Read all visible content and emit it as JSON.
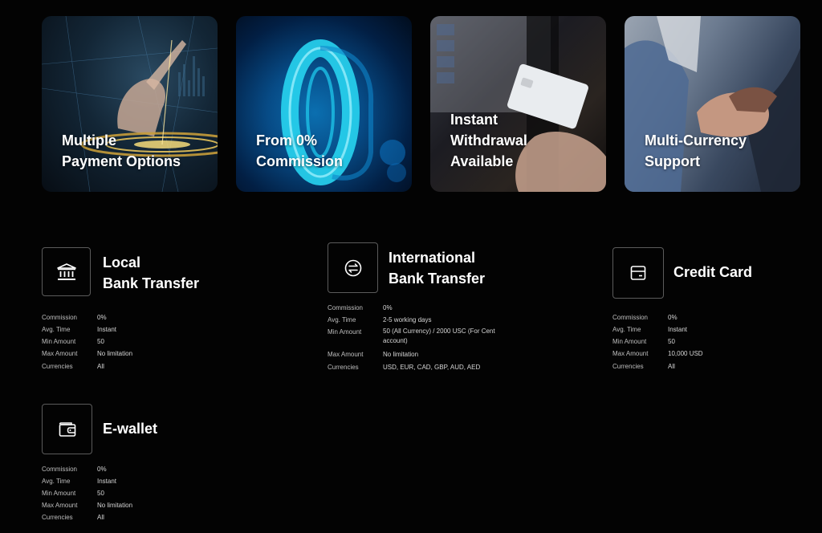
{
  "cards": [
    {
      "lines": [
        "Multiple",
        "Payment Options"
      ]
    },
    {
      "lines": [
        "From 0%",
        "Commission"
      ]
    },
    {
      "lines": [
        "Instant",
        "Withdrawal",
        "Available"
      ]
    },
    {
      "lines": [
        "Multi-Currency",
        "Support"
      ]
    }
  ],
  "methods": {
    "local_bank": {
      "title_lines": [
        "Local",
        "Bank Transfer"
      ],
      "icon": "bank-icon",
      "rows": [
        {
          "label": "Commission",
          "value": "0%"
        },
        {
          "label": "Avg. Time",
          "value": "Instant"
        },
        {
          "label": "Min Amount",
          "value": "50"
        },
        {
          "label": "Max Amount",
          "value": "No limitation"
        },
        {
          "label": "Currencies",
          "value": "All"
        }
      ]
    },
    "international_bank": {
      "title_lines": [
        "International",
        "Bank Transfer"
      ],
      "icon": "exchange-icon",
      "rows": [
        {
          "label": "Commission",
          "value": "0%"
        },
        {
          "label": "Avg. Time",
          "value": "2-5 working days"
        },
        {
          "label": "Min Amount",
          "value": "50 (All Currency) / 2000 USC (For Cent account)"
        },
        {
          "label": "Max Amount",
          "value": "No limitation"
        },
        {
          "label": "Currencies",
          "value": "USD, EUR, CAD, GBP, AUD, AED"
        }
      ]
    },
    "credit_card": {
      "title_lines": [
        "Credit Card"
      ],
      "icon": "credit-card-icon",
      "rows": [
        {
          "label": "Commission",
          "value": "0%"
        },
        {
          "label": "Avg. Time",
          "value": "Instant"
        },
        {
          "label": "Min Amount",
          "value": "50"
        },
        {
          "label": "Max Amount",
          "value": "10,000 USD"
        },
        {
          "label": "Currencies",
          "value": "All"
        }
      ]
    },
    "ewallet": {
      "title_lines": [
        "E-wallet"
      ],
      "icon": "wallet-icon",
      "rows": [
        {
          "label": "Commission",
          "value": "0%"
        },
        {
          "label": "Avg. Time",
          "value": "Instant"
        },
        {
          "label": "Min Amount",
          "value": "50"
        },
        {
          "label": "Max Amount",
          "value": "No limitation"
        },
        {
          "label": "Currencies",
          "value": "All"
        }
      ]
    }
  }
}
